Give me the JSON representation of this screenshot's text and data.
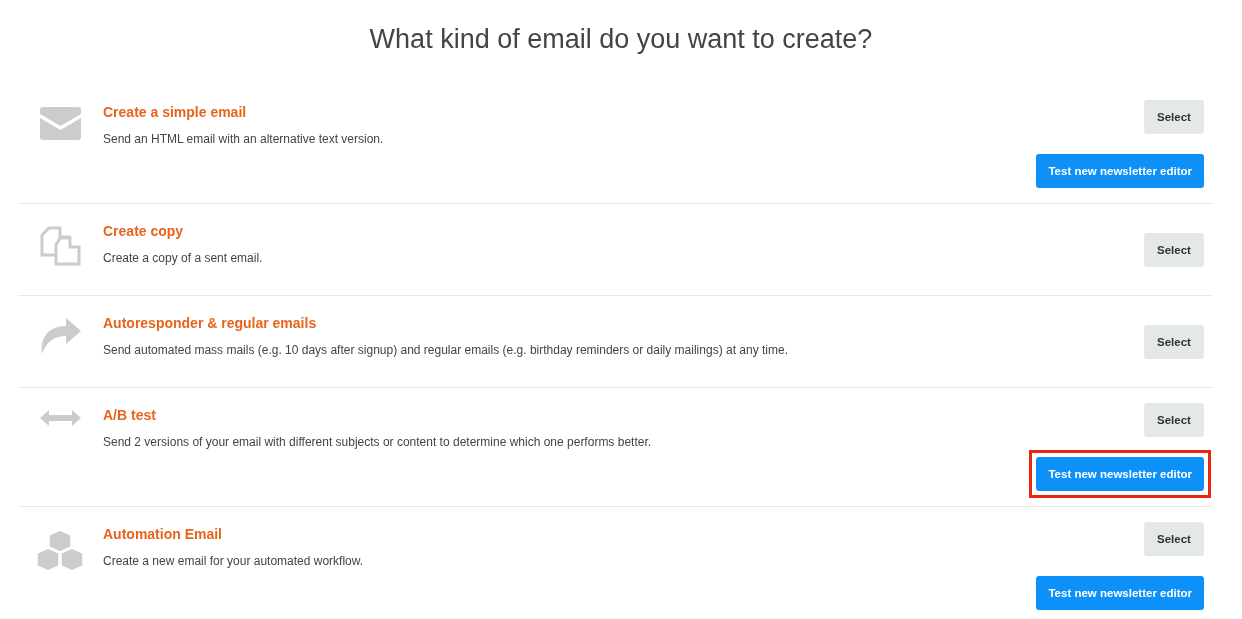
{
  "heading": "What kind of email do you want to create?",
  "options": [
    {
      "title": "Create a simple email",
      "description": "Send an HTML email with an alternative text version.",
      "buttons": [
        {
          "kind": "select",
          "label": "Select",
          "highlighted": false
        },
        {
          "kind": "editor",
          "label": "Test new newsletter editor",
          "highlighted": false
        }
      ]
    },
    {
      "title": "Create copy",
      "description": "Create a copy of a sent email.",
      "buttons": [
        {
          "kind": "select",
          "label": "Select",
          "highlighted": false
        }
      ]
    },
    {
      "title": "Autoresponder & regular emails",
      "description": "Send automated mass mails (e.g. 10 days after signup) and regular emails (e.g. birthday reminders or daily mailings) at any time.",
      "buttons": [
        {
          "kind": "select",
          "label": "Select",
          "highlighted": false
        }
      ]
    },
    {
      "title": "A/B test",
      "description": "Send 2 versions of your email with different subjects or content to determine which one performs better.",
      "buttons": [
        {
          "kind": "select",
          "label": "Select",
          "highlighted": false
        },
        {
          "kind": "editor",
          "label": "Test new newsletter editor",
          "highlighted": true
        }
      ]
    },
    {
      "title": "Automation Email",
      "description": "Create a new email for your automated workflow.",
      "buttons": [
        {
          "kind": "select",
          "label": "Select",
          "highlighted": false
        },
        {
          "kind": "editor",
          "label": "Test new newsletter editor",
          "highlighted": false
        }
      ]
    }
  ]
}
